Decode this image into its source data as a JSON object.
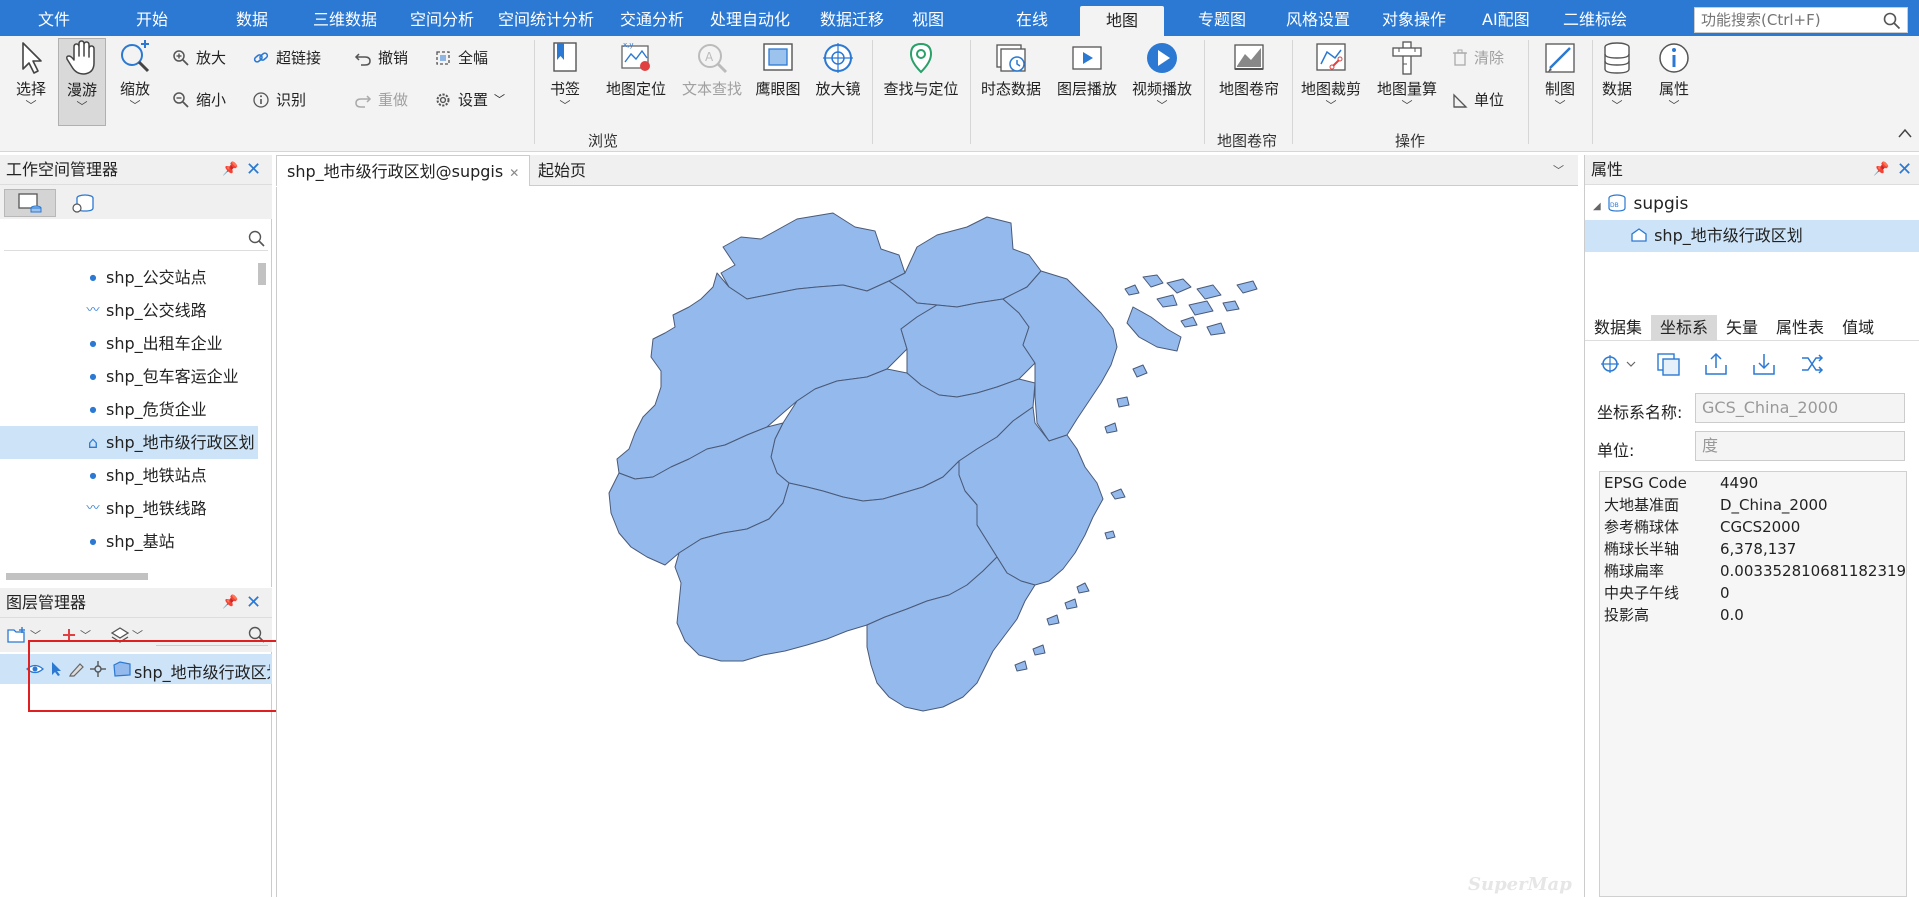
{
  "menu": {
    "items": [
      "文件",
      "开始",
      "数据",
      "三维数据",
      "空间分析",
      "空间统计分析",
      "交通分析",
      "处理自动化",
      "数据迁移",
      "视图",
      "在线",
      "地图",
      "专题图",
      "风格设置",
      "对象操作",
      "AI配图",
      "二维标绘"
    ],
    "active_index": 11,
    "search_placeholder": "功能搜索(Ctrl+F)"
  },
  "ribbon": {
    "select": "选择",
    "pan": "漫游",
    "zoom": "缩放",
    "zoom_in": "放大",
    "zoom_out": "缩小",
    "hyperlink": "超链接",
    "identify": "识别",
    "undo": "撤销",
    "redo": "重做",
    "full_extent": "全幅",
    "settings": "设置",
    "bookmark": "书签",
    "map_locate": "地图定位",
    "text_find": "文本查找",
    "eagle_eye": "鹰眼图",
    "magnifier": "放大镜",
    "find_locate": "查找与定位",
    "temporal_data": "时态数据",
    "layer_play": "图层播放",
    "video_play": "视频播放",
    "map_swipe": "地图卷帘",
    "map_clip": "地图裁剪",
    "map_measure": "地图量算",
    "clear": "清除",
    "unit": "单位",
    "cartography": "制图",
    "data": "数据",
    "properties": "属性",
    "group_browse": "浏览",
    "group_swipe": "地图卷帘",
    "group_operate": "操作"
  },
  "workspace": {
    "title": "工作空间管理器",
    "items": [
      {
        "label": "shp_公交站点",
        "icon": "point",
        "selected": false
      },
      {
        "label": "shp_公交线路",
        "icon": "line",
        "selected": false
      },
      {
        "label": "shp_出租车企业",
        "icon": "point",
        "selected": false
      },
      {
        "label": "shp_包车客运企业",
        "icon": "point",
        "selected": false
      },
      {
        "label": "shp_危货企业",
        "icon": "point",
        "selected": false
      },
      {
        "label": "shp_地市级行政区划",
        "icon": "region",
        "selected": true
      },
      {
        "label": "shp_地铁站点",
        "icon": "point",
        "selected": false
      },
      {
        "label": "shp_地铁线路",
        "icon": "line",
        "selected": false
      },
      {
        "label": "shp_基站",
        "icon": "point",
        "selected": false
      }
    ]
  },
  "layers": {
    "title": "图层管理器",
    "layer_name": "shp_地市级行政区划"
  },
  "map": {
    "tabs": [
      {
        "label": "shp_地市级行政区划@supgis",
        "active": true
      },
      {
        "label": "起始页",
        "active": false
      }
    ],
    "watermark": "SuperMap",
    "region_fill": "#94b9ec",
    "region_stroke": "#4a5a78"
  },
  "properties": {
    "title": "属性",
    "tree_root": "supgis",
    "tree_child": "shp_地市级行政区划",
    "tabs": [
      "数据集",
      "坐标系",
      "矢量",
      "属性表",
      "值域"
    ],
    "active_tab": 1,
    "crs_name_label": "坐标系名称:",
    "crs_name_value": "GCS_China_2000",
    "unit_label": "单位:",
    "unit_value": "度",
    "table": [
      {
        "k": "EPSG Code",
        "v": "4490"
      },
      {
        "k": "大地基准面",
        "v": "D_China_2000"
      },
      {
        "k": "参考椭球体",
        "v": "CGCS2000"
      },
      {
        "k": "椭球长半轴",
        "v": "6,378,137"
      },
      {
        "k": "椭球扁率",
        "v": "0.003352810681182319"
      },
      {
        "k": "中央子午线",
        "v": "0"
      },
      {
        "k": "投影高",
        "v": "0.0"
      }
    ]
  }
}
